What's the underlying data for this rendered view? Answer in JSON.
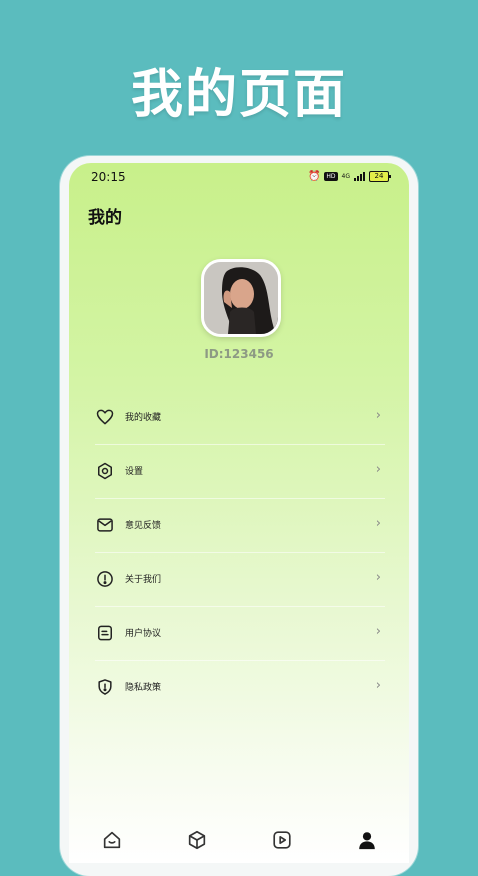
{
  "promo": {
    "title": "我的页面"
  },
  "status_bar": {
    "time": "20:15",
    "battery": "24",
    "net_type": "4G"
  },
  "header": {
    "title": "我的"
  },
  "profile": {
    "id_text": "ID:123456"
  },
  "menu": {
    "items": [
      {
        "label": "我的收藏",
        "icon": "heart-icon"
      },
      {
        "label": "设置",
        "icon": "gear-icon"
      },
      {
        "label": "意见反馈",
        "icon": "mail-icon"
      },
      {
        "label": "关于我们",
        "icon": "info-icon"
      },
      {
        "label": "用户协议",
        "icon": "document-icon"
      },
      {
        "label": "隐私政策",
        "icon": "shield-icon"
      }
    ],
    "chevron": "›"
  },
  "bottom_nav": {
    "items": [
      {
        "icon": "home-icon"
      },
      {
        "icon": "cube-icon"
      },
      {
        "icon": "play-icon"
      },
      {
        "icon": "user-icon",
        "active": true
      }
    ]
  },
  "colors": {
    "background": "#5bbcbe",
    "gradient_top": "#c8f08a",
    "gradient_bottom": "#ffffff"
  }
}
